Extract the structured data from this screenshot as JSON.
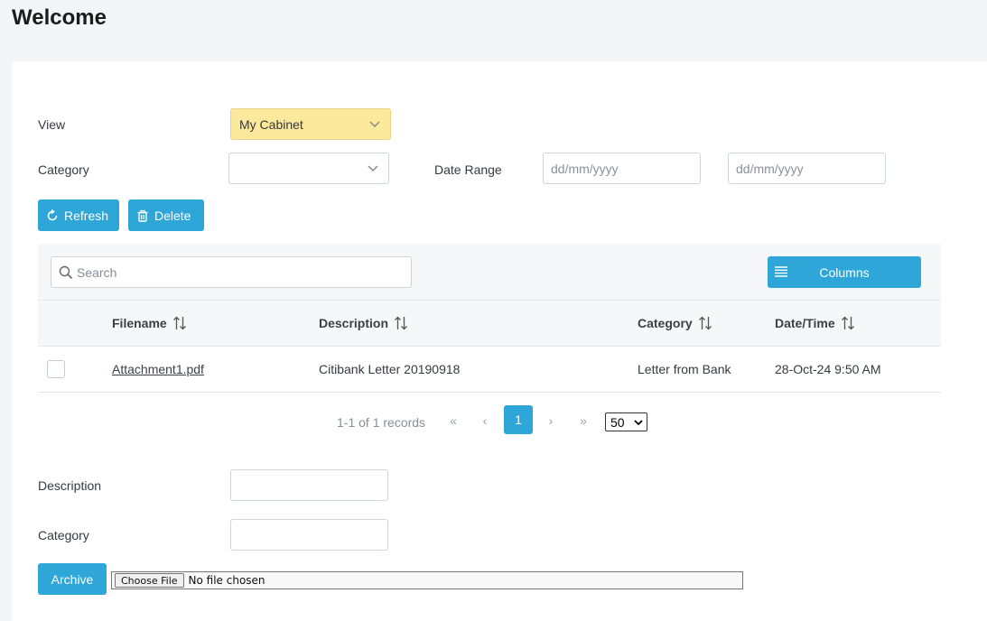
{
  "page": {
    "title": "Welcome"
  },
  "filters": {
    "view_label": "View",
    "view_value": "My Cabinet",
    "category_label": "Category",
    "category_value": "",
    "date_range_label": "Date Range",
    "date_from_placeholder": "dd/mm/yyyy",
    "date_to_placeholder": "dd/mm/yyyy"
  },
  "actions": {
    "refresh_label": "Refresh",
    "delete_label": "Delete"
  },
  "grid": {
    "search_placeholder": "Search",
    "columns_button_label": "Columns",
    "headers": [
      "Filename",
      "Description",
      "Category",
      "Date/Time"
    ],
    "rows": [
      {
        "filename": "Attachment1.pdf",
        "description": "Citibank Letter 20190918",
        "category": "Letter from Bank",
        "datetime": "28-Oct-24 9:50 AM"
      }
    ],
    "pager": {
      "info": "1-1 of 1 records",
      "current_page": "1",
      "page_size": "50"
    }
  },
  "archive_form": {
    "description_label": "Description",
    "description_value": "",
    "category_label": "Category",
    "category_value": "",
    "archive_button_label": "Archive",
    "choose_file_label": "Choose File",
    "no_file_text": "No file chosen"
  },
  "colors": {
    "accent": "#2ea6d8",
    "view_highlight": "#fde99b",
    "page_bg": "#f3f6f9"
  }
}
